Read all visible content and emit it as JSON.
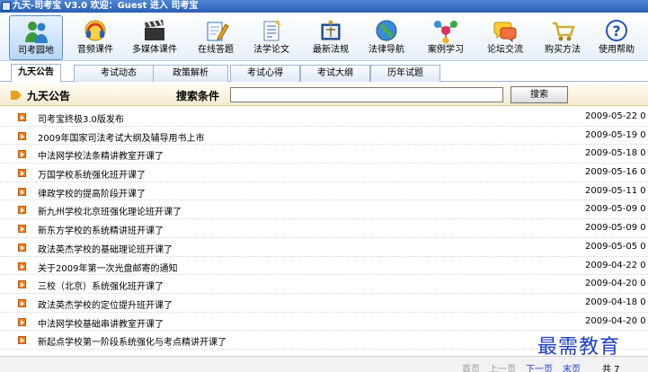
{
  "window": {
    "title": "九天-司考宝 V3.0  欢迎：Guest 进入 司考宝"
  },
  "toolbar": {
    "items": [
      {
        "label": "司考园地",
        "icon": "people-icon"
      },
      {
        "label": "音频课件",
        "icon": "headphones-icon"
      },
      {
        "label": "多媒体课件",
        "icon": "clapperboard-icon"
      },
      {
        "label": "在线答题",
        "icon": "pencil-notebook-icon"
      },
      {
        "label": "法学论文",
        "icon": "paper-icon"
      },
      {
        "label": "最新法规",
        "icon": "law-book-icon"
      },
      {
        "label": "法律导航",
        "icon": "globe-icon"
      },
      {
        "label": "案例学习",
        "icon": "molecule-icon"
      },
      {
        "label": "论坛交流",
        "icon": "chat-icon"
      },
      {
        "label": "购买方法",
        "icon": "cart-icon"
      },
      {
        "label": "使用帮助",
        "icon": "help-icon"
      }
    ]
  },
  "tabs": [
    "九天公告",
    "考试动态",
    "政策解析",
    "考试心得",
    "考试大纲",
    "历年试题"
  ],
  "section": {
    "title": "九天公告"
  },
  "search": {
    "label": "搜索条件",
    "value": "",
    "button": "搜索"
  },
  "announcements": [
    {
      "title": "司考宝终极3.0版发布",
      "date": "2009-05-22 0"
    },
    {
      "title": "2009年国家司法考试大纲及辅导用书上市",
      "date": "2009-05-19 0"
    },
    {
      "title": "中法网学校法条精讲教室开课了",
      "date": "2009-05-18 0"
    },
    {
      "title": "万国学校系统强化班开课了",
      "date": "2009-05-16 0"
    },
    {
      "title": "律政学校的提高阶段开课了",
      "date": "2009-05-11 0"
    },
    {
      "title": "新九州学校北京班强化理论班开课了",
      "date": "2009-05-09 0"
    },
    {
      "title": "新东方学校的系统精讲班开课了",
      "date": "2009-05-09 0"
    },
    {
      "title": "政法英杰学校的基础理论班开课了",
      "date": "2009-05-05 0"
    },
    {
      "title": "关于2009年第一次光盘邮寄的通知",
      "date": "2009-04-22 0"
    },
    {
      "title": "三校（北京）系统强化班开课了",
      "date": "2009-04-20 0"
    },
    {
      "title": "政法英杰学校的定位提升班开课了",
      "date": "2009-04-18 0"
    },
    {
      "title": "中法网学校基础串讲教室开课了",
      "date": "2009-04-20 0"
    },
    {
      "title": "新起点学校第一阶段系统强化与考点精讲开课了",
      "date": ""
    }
  ],
  "pager": {
    "first": "首页",
    "prev": "上一页",
    "next": "下一页",
    "last": "末页",
    "total": "共 7"
  },
  "watermark": "最需教育"
}
